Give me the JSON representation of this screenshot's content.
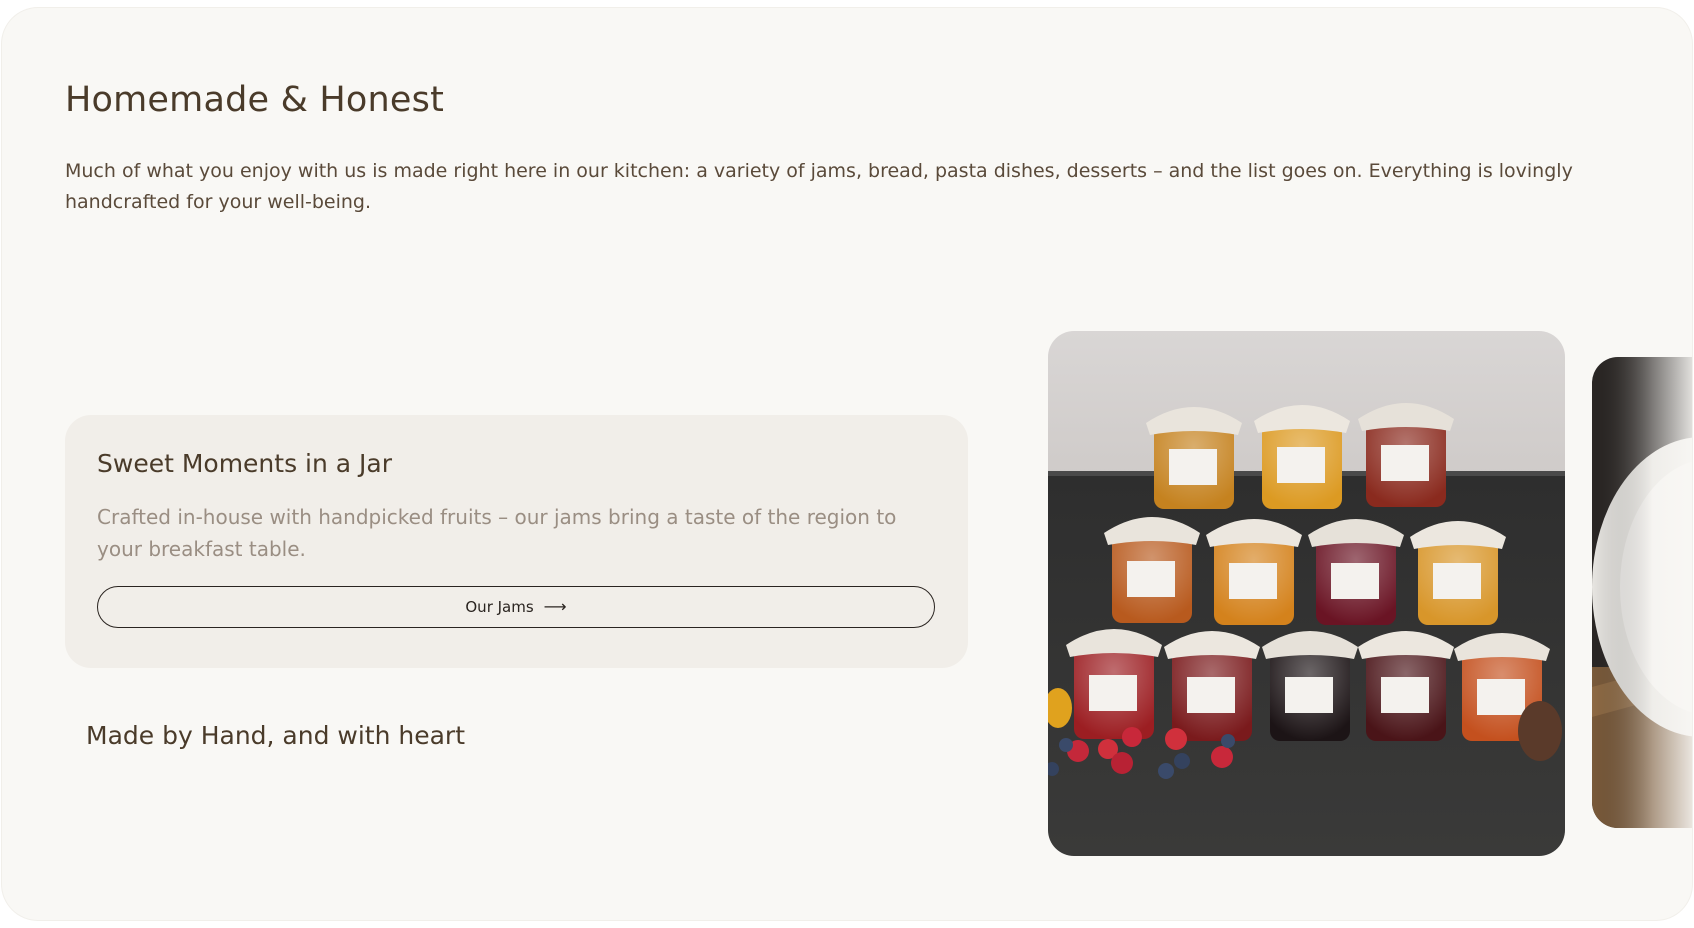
{
  "section": {
    "title": "Homemade & Honest",
    "intro": "Much of what you enjoy with us is made right here in our kitchen: a variety of jams, bread, pasta dishes, desserts – and the list goes on. Everything is lovingly handcrafted for your well-being."
  },
  "card": {
    "title": "Sweet Moments in a Jar",
    "text": "Crafted in-house with handpicked fruits – our jams bring a taste of the region to your breakfast table.",
    "button_label": "Our Jams",
    "button_icon": "arrow-right-icon"
  },
  "tagline": "Made by Hand, and with heart",
  "gallery": {
    "current_image": "jam-jars-photo",
    "next_image": "plate-photo-partial"
  }
}
